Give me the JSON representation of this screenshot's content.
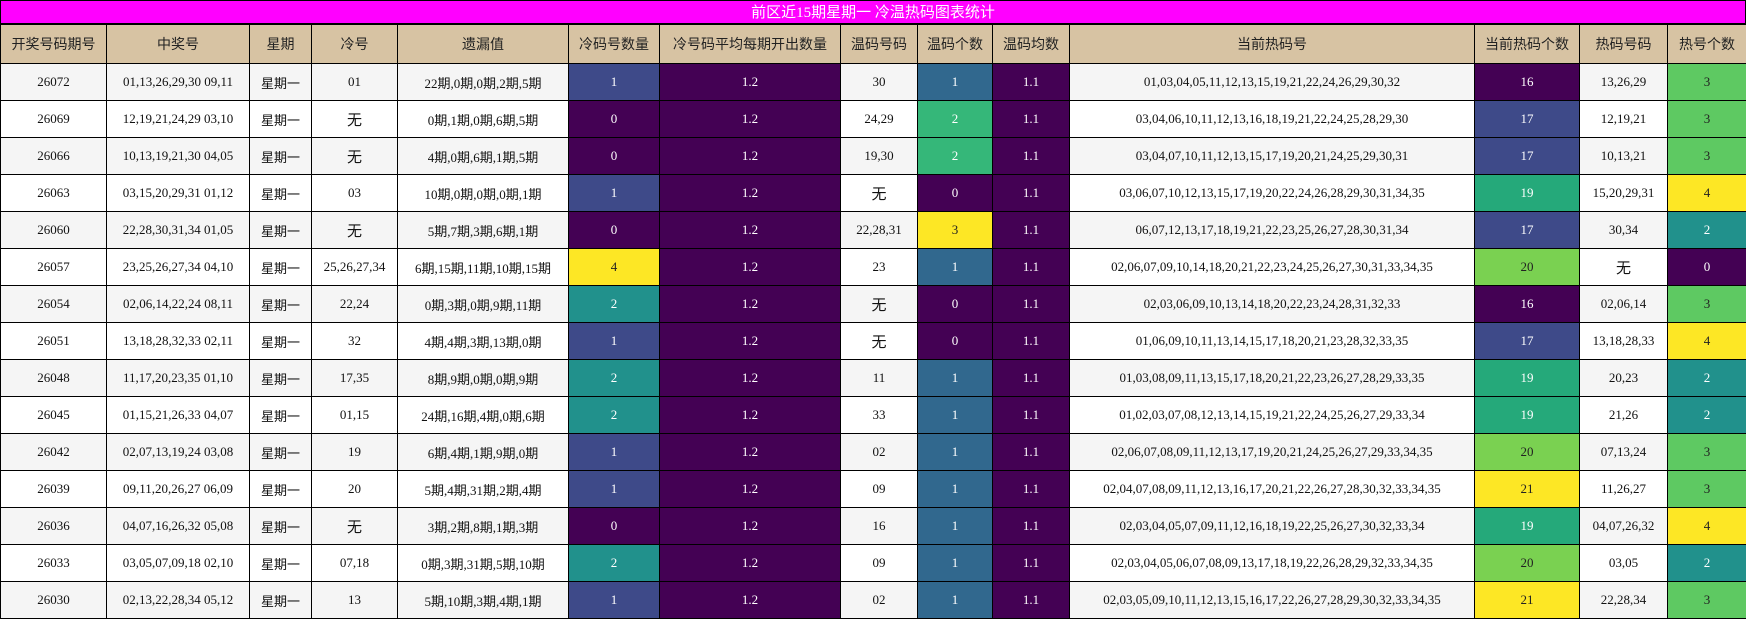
{
  "title": "前区近15期星期一 冷温热码图表统计",
  "colors": {
    "title_bg": "#ff00ff",
    "header_bg": "#d7c3a3",
    "lv_purple": "#440154",
    "lv_slate": "#3e4a89",
    "lv_steel": "#31688e",
    "lv_teal": "#21918c",
    "lv_aqua": "#25a97a",
    "lv_green": "#35b779",
    "lv_lime": "#7ad151",
    "lv_yellow": "#fde725",
    "lv_green_light": "#5ec962"
  },
  "headers": [
    "开奖号码期号",
    "中奖号",
    "星期",
    "冷号",
    "遗漏值",
    "冷码号数量",
    "冷号码平均每期开出数量",
    "温码号码",
    "温码个数",
    "温码均数",
    "当前热码号",
    "当前热码个数",
    "热码号码",
    "热号个数"
  ],
  "rows": [
    {
      "period": "26072",
      "winning": "01,13,26,29,30 09,11",
      "weekday": "星期一",
      "cold": "01",
      "omission": "22期,0期,0期,2期,5期",
      "cold_count": "1",
      "cold_avg": "1.2",
      "warm": "30",
      "warm_count": "1",
      "warm_avg": "1.1",
      "hot_current": "01,03,04,05,11,12,13,15,19,21,22,24,26,29,30,32",
      "hot_current_count": "16",
      "hot": "13,26,29",
      "hot_count": "3"
    },
    {
      "period": "26069",
      "winning": "12,19,21,24,29 03,10",
      "weekday": "星期一",
      "cold": "无",
      "omission": "0期,1期,0期,6期,5期",
      "cold_count": "0",
      "cold_avg": "1.2",
      "warm": "24,29",
      "warm_count": "2",
      "warm_avg": "1.1",
      "hot_current": "03,04,06,10,11,12,13,16,18,19,21,22,24,25,28,29,30",
      "hot_current_count": "17",
      "hot": "12,19,21",
      "hot_count": "3"
    },
    {
      "period": "26066",
      "winning": "10,13,19,21,30 04,05",
      "weekday": "星期一",
      "cold": "无",
      "omission": "4期,0期,6期,1期,5期",
      "cold_count": "0",
      "cold_avg": "1.2",
      "warm": "19,30",
      "warm_count": "2",
      "warm_avg": "1.1",
      "hot_current": "03,04,07,10,11,12,13,15,17,19,20,21,24,25,29,30,31",
      "hot_current_count": "17",
      "hot": "10,13,21",
      "hot_count": "3"
    },
    {
      "period": "26063",
      "winning": "03,15,20,29,31 01,12",
      "weekday": "星期一",
      "cold": "03",
      "omission": "10期,0期,0期,0期,1期",
      "cold_count": "1",
      "cold_avg": "1.2",
      "warm": "无",
      "warm_count": "0",
      "warm_avg": "1.1",
      "hot_current": "03,06,07,10,12,13,15,17,19,20,22,24,26,28,29,30,31,34,35",
      "hot_current_count": "19",
      "hot": "15,20,29,31",
      "hot_count": "4"
    },
    {
      "period": "26060",
      "winning": "22,28,30,31,34 01,05",
      "weekday": "星期一",
      "cold": "无",
      "omission": "5期,7期,3期,6期,1期",
      "cold_count": "0",
      "cold_avg": "1.2",
      "warm": "22,28,31",
      "warm_count": "3",
      "warm_avg": "1.1",
      "hot_current": "06,07,12,13,17,18,19,21,22,23,25,26,27,28,30,31,34",
      "hot_current_count": "17",
      "hot": "30,34",
      "hot_count": "2"
    },
    {
      "period": "26057",
      "winning": "23,25,26,27,34 04,10",
      "weekday": "星期一",
      "cold": "25,26,27,34",
      "omission": "6期,15期,11期,10期,15期",
      "cold_count": "4",
      "cold_avg": "1.2",
      "warm": "23",
      "warm_count": "1",
      "warm_avg": "1.1",
      "hot_current": "02,06,07,09,10,14,18,20,21,22,23,24,25,26,27,30,31,33,34,35",
      "hot_current_count": "20",
      "hot": "无",
      "hot_count": "0"
    },
    {
      "period": "26054",
      "winning": "02,06,14,22,24 08,11",
      "weekday": "星期一",
      "cold": "22,24",
      "omission": "0期,3期,0期,9期,11期",
      "cold_count": "2",
      "cold_avg": "1.2",
      "warm": "无",
      "warm_count": "0",
      "warm_avg": "1.1",
      "hot_current": "02,03,06,09,10,13,14,18,20,22,23,24,28,31,32,33",
      "hot_current_count": "16",
      "hot": "02,06,14",
      "hot_count": "3"
    },
    {
      "period": "26051",
      "winning": "13,18,28,32,33 02,11",
      "weekday": "星期一",
      "cold": "32",
      "omission": "4期,4期,3期,13期,0期",
      "cold_count": "1",
      "cold_avg": "1.2",
      "warm": "无",
      "warm_count": "0",
      "warm_avg": "1.1",
      "hot_current": "01,06,09,10,11,13,14,15,17,18,20,21,23,28,32,33,35",
      "hot_current_count": "17",
      "hot": "13,18,28,33",
      "hot_count": "4"
    },
    {
      "period": "26048",
      "winning": "11,17,20,23,35 01,10",
      "weekday": "星期一",
      "cold": "17,35",
      "omission": "8期,9期,0期,0期,9期",
      "cold_count": "2",
      "cold_avg": "1.2",
      "warm": "11",
      "warm_count": "1",
      "warm_avg": "1.1",
      "hot_current": "01,03,08,09,11,13,15,17,18,20,21,22,23,26,27,28,29,33,35",
      "hot_current_count": "19",
      "hot": "20,23",
      "hot_count": "2"
    },
    {
      "period": "26045",
      "winning": "01,15,21,26,33 04,07",
      "weekday": "星期一",
      "cold": "01,15",
      "omission": "24期,16期,4期,0期,6期",
      "cold_count": "2",
      "cold_avg": "1.2",
      "warm": "33",
      "warm_count": "1",
      "warm_avg": "1.1",
      "hot_current": "01,02,03,07,08,12,13,14,15,19,21,22,24,25,26,27,29,33,34",
      "hot_current_count": "19",
      "hot": "21,26",
      "hot_count": "2"
    },
    {
      "period": "26042",
      "winning": "02,07,13,19,24 03,08",
      "weekday": "星期一",
      "cold": "19",
      "omission": "6期,4期,1期,9期,0期",
      "cold_count": "1",
      "cold_avg": "1.2",
      "warm": "02",
      "warm_count": "1",
      "warm_avg": "1.1",
      "hot_current": "02,06,07,08,09,11,12,13,17,19,20,21,24,25,26,27,29,33,34,35",
      "hot_current_count": "20",
      "hot": "07,13,24",
      "hot_count": "3"
    },
    {
      "period": "26039",
      "winning": "09,11,20,26,27 06,09",
      "weekday": "星期一",
      "cold": "20",
      "omission": "5期,4期,31期,2期,4期",
      "cold_count": "1",
      "cold_avg": "1.2",
      "warm": "09",
      "warm_count": "1",
      "warm_avg": "1.1",
      "hot_current": "02,04,07,08,09,11,12,13,16,17,20,21,22,26,27,28,30,32,33,34,35",
      "hot_current_count": "21",
      "hot": "11,26,27",
      "hot_count": "3"
    },
    {
      "period": "26036",
      "winning": "04,07,16,26,32 05,08",
      "weekday": "星期一",
      "cold": "无",
      "omission": "3期,2期,8期,1期,3期",
      "cold_count": "0",
      "cold_avg": "1.2",
      "warm": "16",
      "warm_count": "1",
      "warm_avg": "1.1",
      "hot_current": "02,03,04,05,07,09,11,12,16,18,19,22,25,26,27,30,32,33,34",
      "hot_current_count": "19",
      "hot": "04,07,26,32",
      "hot_count": "4"
    },
    {
      "period": "26033",
      "winning": "03,05,07,09,18 02,10",
      "weekday": "星期一",
      "cold": "07,18",
      "omission": "0期,3期,31期,5期,10期",
      "cold_count": "2",
      "cold_avg": "1.2",
      "warm": "09",
      "warm_count": "1",
      "warm_avg": "1.1",
      "hot_current": "02,03,04,05,06,07,08,09,13,17,18,19,22,26,28,29,32,33,34,35",
      "hot_current_count": "20",
      "hot": "03,05",
      "hot_count": "2"
    },
    {
      "period": "26030",
      "winning": "02,13,22,28,34 05,12",
      "weekday": "星期一",
      "cold": "13",
      "omission": "5期,10期,3期,4期,1期",
      "cold_count": "1",
      "cold_avg": "1.2",
      "warm": "02",
      "warm_count": "1",
      "warm_avg": "1.1",
      "hot_current": "02,03,05,09,10,11,12,13,15,16,17,22,26,27,28,29,30,32,33,34,35",
      "hot_current_count": "21",
      "hot": "22,28,34",
      "hot_count": "3"
    }
  ]
}
